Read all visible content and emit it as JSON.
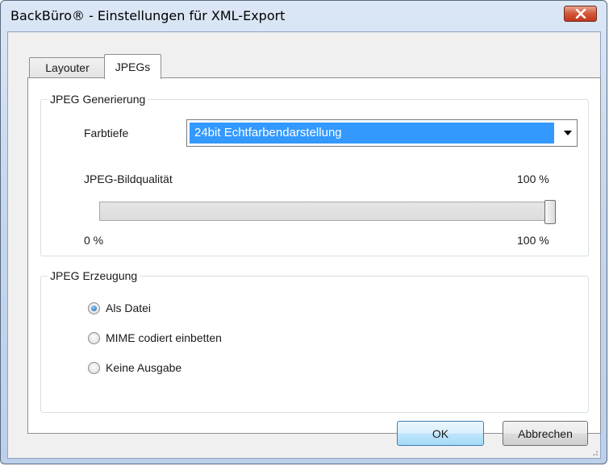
{
  "window": {
    "title": "BackBüro® - Einstellungen für XML-Export"
  },
  "tabs": [
    {
      "label": "Layouter",
      "active": false
    },
    {
      "label": "JPEGs",
      "active": true
    }
  ],
  "generierung": {
    "title": "JPEG Generierung",
    "farbtiefe_label": "Farbtiefe",
    "farbtiefe_value": "24bit Echtfarbendarstellung",
    "quality_label": "JPEG-Bildqualität",
    "quality_value": "100 %",
    "slider_min_label": "0 %",
    "slider_max_label": "100 %",
    "slider_value_percent": 100
  },
  "erzeugung": {
    "title": "JPEG Erzeugung",
    "options": [
      {
        "label": "Als Datei",
        "checked": true
      },
      {
        "label": "MIME codiert einbetten",
        "checked": false
      },
      {
        "label": "Keine Ausgabe",
        "checked": false
      }
    ]
  },
  "buttons": {
    "ok": "OK",
    "cancel": "Abbrechen"
  },
  "colors": {
    "selection": "#3399ff",
    "close": "#c7432a"
  }
}
